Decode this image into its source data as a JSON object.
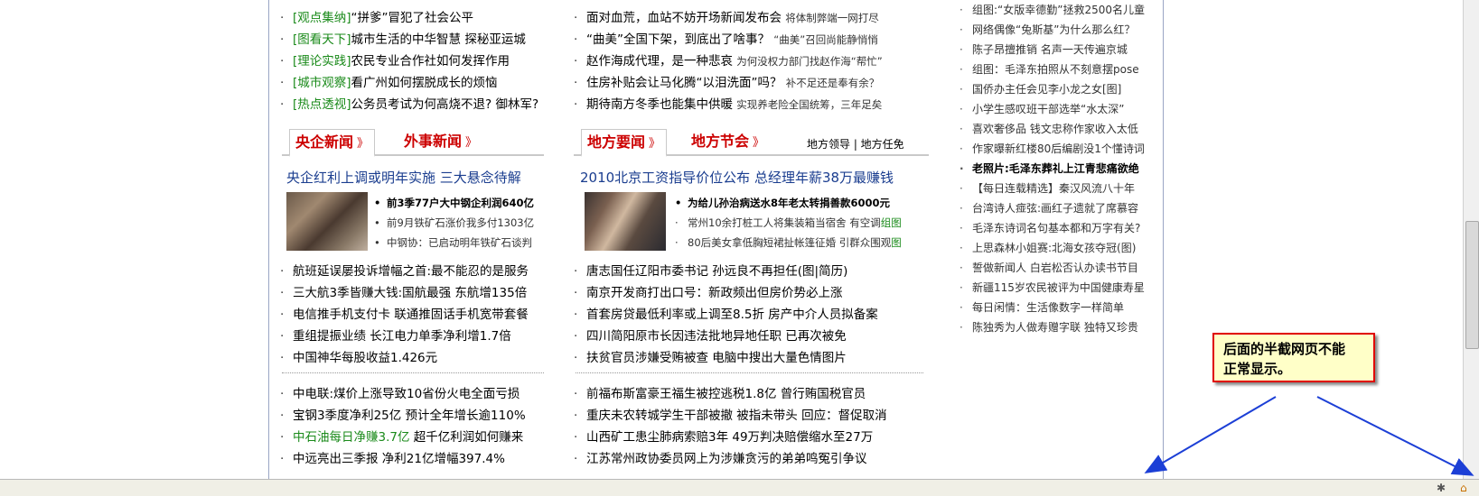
{
  "left_col": {
    "top_items": [
      {
        "tag": "[观点集纳]",
        "text": "“拼爹”冒犯了社会公平"
      },
      {
        "tag": "[图看天下]",
        "text": "城市生活的中华智慧 探秘亚运城"
      },
      {
        "tag": "[理论实践]",
        "text": "农民专业合作社如何发挥作用"
      },
      {
        "tag": "[城市观察]",
        "text": "看广州如何摆脱成长的烦恼"
      },
      {
        "tag": "[热点透视]",
        "text": "公务员考试为何高烧不退? 御林军?"
      }
    ],
    "tabs": [
      "央企新闻",
      "外事新闻"
    ],
    "arrow": "》",
    "headline": "央企红利上调或明年实施 三大悬念待解",
    "photo_subs": [
      "前3季77户大中钢企利润640亿",
      "前9月铁矿石涨价我多付1303亿",
      "中钢协：已启动明年铁矿石谈判"
    ],
    "list1": [
      "航班延误屡投诉增幅之首:最不能忍的是服务",
      "三大航3季皆赚大钱:国航最强 东航增135倍",
      "电信推手机支付卡 联通推固话手机宽带套餐",
      "重组提振业绩 长江电力单季净利增1.7倍",
      "中国神华每股收益1.426元"
    ],
    "list2": [
      {
        "text": "中电联:煤价上涨导致10省份火电全面亏损",
        "green": false
      },
      {
        "text": "宝钢3季度净利25亿 预计全年增长逾110%",
        "green": false
      },
      {
        "text": "中石油每日净赚3.7亿",
        "extra": "超千亿利润如何赚来",
        "green": true
      },
      {
        "text": "中远亮出三季报 净利21亿增幅397.4%",
        "green": false
      }
    ]
  },
  "mid_col": {
    "top_items": [
      {
        "text": "面对血荒，血站不妨开场新闻发布会",
        "small": "将体制弊端一网打尽"
      },
      {
        "text": "“曲美”全国下架，到底出了啥事？",
        "small": "“曲美”召回尚能静悄悄"
      },
      {
        "text": "赵作海成代理，是一种悲哀",
        "small": "为何没权力部门找赵作海“帮忙”"
      },
      {
        "text": "住房补贴会让马化腾“以泪洗面”吗？",
        "small": "补不足还是奉有余？"
      },
      {
        "text": "期待南方冬季也能集中供暖",
        "small": "实现养老险全国统筹，三年足矣"
      }
    ],
    "tabs": [
      "地方要闻",
      "地方节会"
    ],
    "tab_links": "地方领导 | 地方任免",
    "headline": "2010北京工资指导价位公布 总经理年薪38万最赚钱",
    "photo_subs": [
      {
        "text": "为给儿孙治病送水8年老太转捐善款6000元",
        "bold": true
      },
      {
        "text": "常州10余打桩工人将集装箱当宿舍 有空调",
        "green": "组图"
      },
      {
        "text": "80后美女拿低胸短裙扯帐篷征婚 引群众围观",
        "green": "图"
      }
    ],
    "list1": [
      "唐志国任辽阳市委书记 孙远良不再担任(图|简历)",
      "南京开发商打出口号：新政频出但房价势必上涨",
      "首套房贷最低利率或上调至8.5折 房产中介人员拟备案",
      "四川简阳原市长因违法批地异地任职 已再次被免",
      "扶贫官员涉嫌受贿被查 电脑中搜出大量色情图片"
    ],
    "list2": [
      "前福布斯富豪王福生被控逃税1.8亿 曾行贿国税官员",
      "重庆未农转城学生干部被撤 被指未带头 回应：督促取消",
      "山西矿工患尘肺病索赔3年 49万判决赔偿缩水至27万",
      "江苏常州政协委员网上为涉嫌贪污的弟弟鸣冤引争议"
    ]
  },
  "right_col": {
    "items": [
      {
        "text": "组图:“女版幸德勤”拯救2500名儿童",
        "bold": false
      },
      {
        "text": "网络偶像“兔斯基”为什么那么红？",
        "bold": false
      },
      {
        "text": "陈子昂擅推销 名声一天传遍京城",
        "bold": false
      },
      {
        "text": "组图：毛泽东拍照从不刻意摆pose",
        "bold": false
      },
      {
        "text": "国侨办主任会见李小龙之女[图]",
        "bold": false
      },
      {
        "text": "小学生感叹班干部选举“水太深”",
        "bold": false
      },
      {
        "text": "喜欢奢侈品 钱文忠称作家收入太低",
        "bold": false
      },
      {
        "text": "作家曝新红楼80后编剧没1个懂诗词",
        "bold": false
      },
      {
        "text": "老照片:毛泽东葬礼上江青悲痛欲绝",
        "bold": true
      },
      {
        "text": "【每日连载精选】秦汉风流八十年",
        "bold": false
      },
      {
        "text": "台湾诗人痖弦:画红子遗就了席慕容",
        "bold": false
      },
      {
        "text": "毛泽东诗词名句基本都和万字有关?",
        "bold": false
      },
      {
        "text": "上思森林小姐赛:北海女孩夺冠(图)",
        "bold": false
      },
      {
        "text": "誓做新闻人 白岩松否认办读书节目",
        "bold": false
      },
      {
        "text": "新疆115岁农民被评为中国健康寿星",
        "bold": false
      },
      {
        "text": "每日闲情：生活像数字一样简单",
        "bold": false
      },
      {
        "text": "陈独秀为人做寿赠字联 独特又珍贵",
        "bold": false
      }
    ]
  },
  "callout": {
    "line1": "后面的半截网页不能",
    "line2": "正常显示。"
  },
  "colors": {
    "tab_red": "#cc0000",
    "headline_blue": "#1a3d8f",
    "tag_green": "#1a8a1a",
    "arrow_blue": "#1c3fd6"
  }
}
